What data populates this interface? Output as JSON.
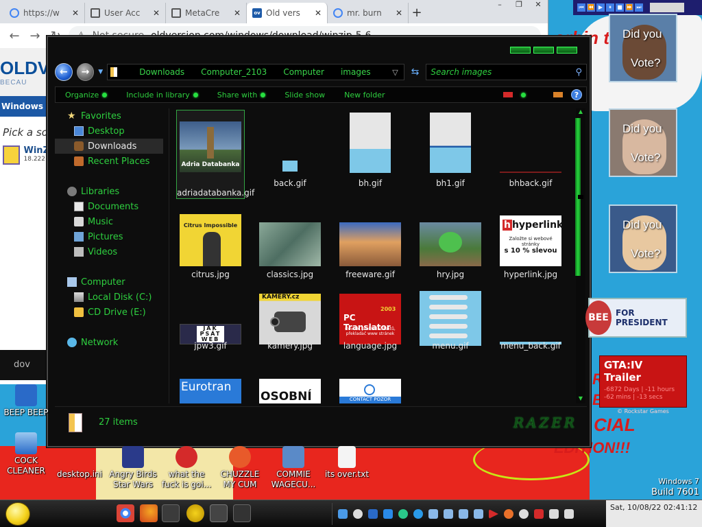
{
  "browser": {
    "tabs": [
      {
        "label": "https://w"
      },
      {
        "label": "User Acc"
      },
      {
        "label": "MetaCre"
      },
      {
        "label": "Old vers",
        "active": true,
        "favicon": "ov"
      },
      {
        "label": "mr. burn"
      }
    ],
    "window_controls": [
      "–",
      "❐",
      "✕"
    ],
    "address_security": "Not secure",
    "address_url": "oldversion.com/windows/download/winzip-5-6",
    "site": {
      "logo": "OLDV",
      "logo_sub": "BECAU",
      "nav_label": "Windows",
      "pick": "Pick a so",
      "item_title": "WinZ",
      "item_sub": "18.222"
    },
    "download_bar": "dov"
  },
  "explorer": {
    "breadcrumbs": [
      "Downloads",
      "Computer_2103",
      "Computer",
      "images"
    ],
    "search_placeholder": "Search images",
    "commands": [
      "Organize",
      "Include in library",
      "Share with",
      "Slide show",
      "New folder"
    ],
    "nav": {
      "favorites_header": "Favorites",
      "favorites": [
        "Desktop",
        "Downloads",
        "Recent Places"
      ],
      "libraries_header": "Libraries",
      "libraries": [
        "Documents",
        "Music",
        "Pictures",
        "Videos"
      ],
      "computer_header": "Computer",
      "drives": [
        "Local Disk (C:)",
        "CD Drive (E:)"
      ],
      "network": "Network"
    },
    "files": [
      {
        "name": "adriadatabanka.gif"
      },
      {
        "name": "back.gif"
      },
      {
        "name": "bh.gif"
      },
      {
        "name": "bh1.gif"
      },
      {
        "name": "bhback.gif"
      },
      {
        "name": "citrus.jpg"
      },
      {
        "name": "classics.jpg"
      },
      {
        "name": "freeware.gif"
      },
      {
        "name": "hry.jpg"
      },
      {
        "name": "hyperlink.jpg"
      },
      {
        "name": "jpw3.gif"
      },
      {
        "name": "kamery.jpg"
      },
      {
        "name": "language.jpg"
      },
      {
        "name": "menu.gif"
      },
      {
        "name": "menu_back.gif"
      }
    ],
    "thumb_text": {
      "adria": "Adria Databanka",
      "citrus": "Citrus Impossible",
      "hyperlink": "hyperlink",
      "hyperlink_sub": "Založte si webové stránky",
      "hyperlink_price": "s 10 % slevou",
      "jpw3": "JAK PSÁT WEB",
      "kamery": "KAMERY.cz",
      "language_title": "PC Translator",
      "language_year": "2003",
      "language_sub": "slovník, překladač textů, překladač www stránek",
      "eurotran": "Eurotran",
      "osobni": "OSOBNÍ",
      "contact": "CONTACT POZOR"
    },
    "status_count": "27 items",
    "brand": "RAZER"
  },
  "gadgets": {
    "vote_top": "Did you",
    "vote_bottom": "Vote?",
    "huckabee_badge": "BEE",
    "huckabee_text": "FOR PRESIDENT",
    "gta_title": "GTA:IV Trailer",
    "gta_countdown": "-6872 Days | -11 hours",
    "gta_countdown2": "-62 mins | -13 secs",
    "gta_footer": "© Rockstar Games",
    "wallpaper_text1": "orbin t",
    "wallpaper_text2": "CIAL",
    "wallpaper_text3": "EDITION!!!",
    "wallpaper_text4": "R",
    "wallpaper_text5": "E"
  },
  "desktop_icons": [
    {
      "label": "BEEP BEEP"
    },
    {
      "label": "COCK CLEANER"
    },
    {
      "label": "desktop.ini"
    },
    {
      "label": "Angry Birds Star Wars"
    },
    {
      "label": "what the fuck is goi..."
    },
    {
      "label": "CHUZZLE MY CUM"
    },
    {
      "label": "COMMIE WAGECU..."
    },
    {
      "label": "its over.txt"
    }
  ],
  "windows_version": {
    "line1": "Windows 7",
    "line2": "Build 7601"
  },
  "taskbar": {
    "clock": "Sat, 10/08/22 02:41:12"
  }
}
